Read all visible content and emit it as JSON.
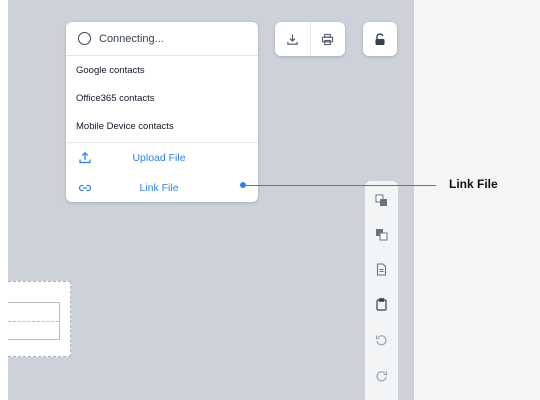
{
  "status": {
    "text": "Connecting..."
  },
  "menu": {
    "items": [
      {
        "label": "Google contacts"
      },
      {
        "label": "Office365 contacts"
      },
      {
        "label": "Mobile Device contacts"
      }
    ],
    "actions": [
      {
        "label": "Upload File",
        "icon": "upload-icon"
      },
      {
        "label": "Link File",
        "icon": "link-icon"
      }
    ]
  },
  "toolbar": {
    "top": [
      "download-icon",
      "print-icon",
      "unlock-icon"
    ],
    "side": [
      "bring-forward-icon",
      "send-backward-icon",
      "copy-icon",
      "paste-icon",
      "undo-icon",
      "redo-icon"
    ]
  },
  "callout": {
    "label": "Link File"
  },
  "colors": {
    "accent": "#2f80ed",
    "canvas": "#cdd1da"
  }
}
